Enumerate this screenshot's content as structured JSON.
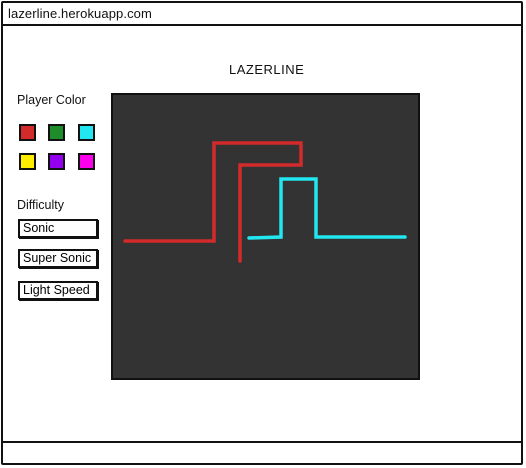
{
  "browser": {
    "url": "lazerline.herokuapp.com"
  },
  "app": {
    "title": "LAZERLINE"
  },
  "player_color": {
    "label": "Player Color",
    "swatches": [
      {
        "name": "red",
        "color": "#d32b2b"
      },
      {
        "name": "green",
        "color": "#1e8c2a"
      },
      {
        "name": "cyan",
        "color": "#22e6f0"
      },
      {
        "name": "yellow",
        "color": "#ffee00"
      },
      {
        "name": "purple",
        "color": "#9400ee"
      },
      {
        "name": "magenta",
        "color": "#ff00ee"
      }
    ]
  },
  "difficulty": {
    "label": "Difficulty",
    "options": [
      "Sonic",
      "Super Sonic",
      "Light Speed"
    ]
  },
  "game_canvas": {
    "background": "#333333",
    "trail_colors": {
      "red": "#d32b2b",
      "cyan": "#22e6f0"
    }
  }
}
